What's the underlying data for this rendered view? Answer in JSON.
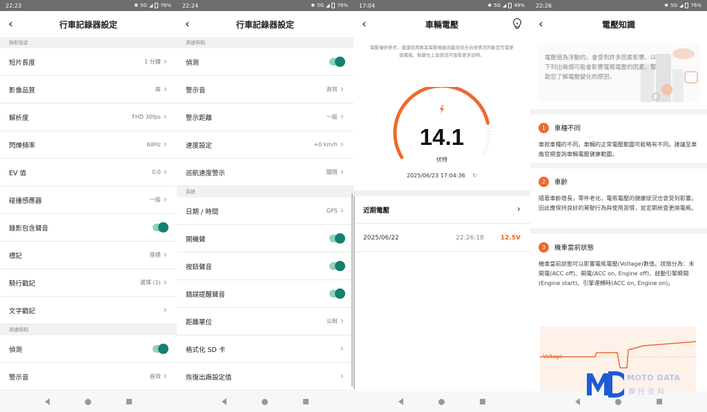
{
  "panels": [
    {
      "time": "22:23",
      "battery": "76%",
      "network": "5G",
      "title": "行車記錄器設定"
    },
    {
      "time": "22:24",
      "battery": "76%",
      "network": "5G",
      "title": "行車記錄器設定"
    },
    {
      "time": "17:04",
      "battery": "49%",
      "network": "5G",
      "title": "車輛電壓"
    },
    {
      "time": "22:26",
      "battery": "76%",
      "network": "5G",
      "title": "電壓知識"
    }
  ],
  "p1": {
    "section1": "錄影設定",
    "rows": [
      {
        "label": "短片長度",
        "value": "1 分鐘"
      },
      {
        "label": "影像品質",
        "value": "高"
      },
      {
        "label": "解析度",
        "value": "FHD 30fps"
      },
      {
        "label": "閃爍頻率",
        "value": "60Hz"
      },
      {
        "label": "EV 值",
        "value": "0.0"
      },
      {
        "label": "碰撞感應器",
        "value": "一般"
      }
    ],
    "toggle_row": "錄影包含聲音",
    "rows2": [
      {
        "label": "標記",
        "value": "座標"
      },
      {
        "label": "騎行戳記",
        "value": "選擇 (1)"
      },
      {
        "label": "文字戳記",
        "value": ""
      }
    ],
    "section2": "測速照相",
    "detect": "偵測",
    "alarm": {
      "label": "警示音",
      "value": "音效"
    }
  },
  "p2": {
    "section1": "測速照相",
    "detect": "偵測",
    "rows": [
      {
        "label": "警示音",
        "value": "音效"
      },
      {
        "label": "警示距離",
        "value": "一般"
      },
      {
        "label": "速度設定",
        "value": "+0 km/h"
      },
      {
        "label": "巡航速度警示",
        "value": "關閉"
      }
    ],
    "section2": "系統",
    "datetime": {
      "label": "日期 / 時間",
      "value": "GPS"
    },
    "toggles": [
      "開機聲",
      "按鈕聲音",
      "錯誤提醒聲音"
    ],
    "unit": {
      "label": "距離單位",
      "value": "公制"
    },
    "format": "格式化 SD 卡",
    "reset": "恢復出廠設定值"
  },
  "p3": {
    "note": "電壓僅供參考，建議使用專業電壓儀器測量並結合自身情況判斷是否需更換電瓶。點擊右上角燈泡可查看更多說明。",
    "voltage": "14.1",
    "unit": "伏特",
    "timestamp": "2025/06/23 17:04:36",
    "recent_label": "近期電壓",
    "recent": {
      "date": "2025/06/22",
      "time": "22:26:18",
      "value": "12.5V"
    },
    "gauge_level": 0.82,
    "accent": "#ee6a2e"
  },
  "p4": {
    "intro": "電壓值為浮動的，會受到許多因素影響。以下列出幾個可能會影響電瓶電壓的因素，幫助您了解電壓變化的原因。",
    "cards": [
      {
        "num": "1",
        "title": "車種不同",
        "body": "車款車種的不同，車輛的正常電壓範圍可能略有不同。建議至車廠官網查詢車輛電壓健康範圍。"
      },
      {
        "num": "2",
        "title": "車齡",
        "body": "隨著車齡增長，零件老化，電瓶電壓的健康狀況也會受到影響。因此應保持良好的駕駛行為與使用習慣，並定期檢查更換電瓶。"
      },
      {
        "num": "3",
        "title": "機車當前狀態",
        "body": "機車當前狀態可以影響電瓶電壓(Voltage)數值。狀態分為：未開電(ACC off)、開電(ACC on, Engine off)、啟動引擎瞬間(Engine start)、引擎運轉時(ACC on, Engine on)。"
      }
    ],
    "chart_label": "Voltage"
  },
  "watermark": {
    "brand": "MOTO DATA",
    "sub": "摩托百科"
  }
}
